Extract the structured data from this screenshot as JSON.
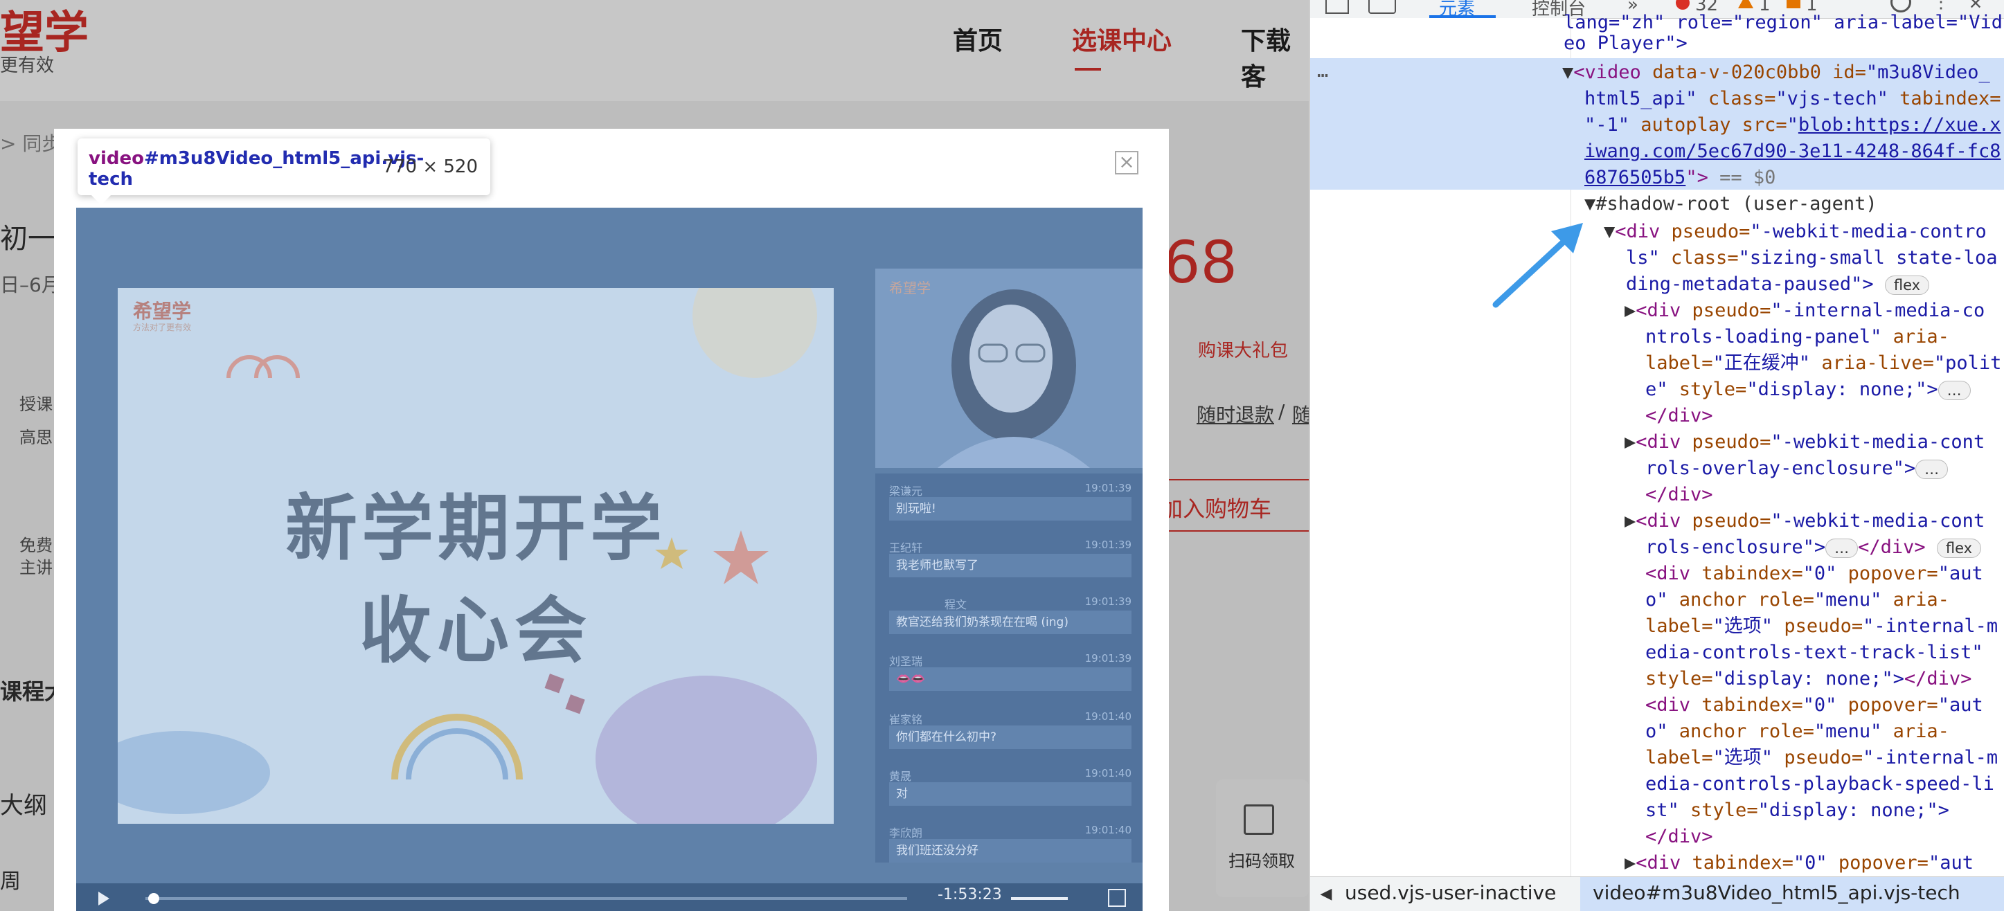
{
  "site": {
    "logo_text": "望学",
    "logo_sub": "更有效",
    "nav": [
      {
        "label": "首页"
      },
      {
        "label": "选课中心"
      },
      {
        "label": "下载客"
      }
    ],
    "breadcrumb": "> 同步",
    "course_title": "初一",
    "course_date": "日–6月",
    "price": "68",
    "gift_badge": "购课大礼包",
    "refund_text": "随时退款",
    "refund_sep": "/",
    "refund_more": "随",
    "add_cart": "加入购物车",
    "teacher_label": "授课",
    "teacher_name": "高思",
    "free_label": "免费",
    "free_sub": "主讲",
    "outline_title": "课程大纲",
    "outline_label": "大纲",
    "week_label": "周",
    "scan_label": "扫码领取"
  },
  "modal": {
    "close_label": "×",
    "tooltip_element": "video",
    "tooltip_selector": "#m3u8Video_html5_api.vjs-tech",
    "tooltip_size": "770 × 520"
  },
  "video": {
    "slide_logo": "希望学",
    "slide_logo_sub": "方法对了更有效",
    "slide_title_line1": "新学期开学",
    "slide_title_line2": "收心会",
    "teacher_logo": "希望学",
    "chat": [
      {
        "name": "梁谦元",
        "time": "19:01:39",
        "msg": "别玩啦!"
      },
      {
        "name": "王纪轩",
        "time": "19:01:39",
        "msg": "我老师也默写了"
      },
      {
        "name": "程文",
        "time": "19:01:39",
        "msg": "教官还给我们奶茶现在在喝 (ing)"
      },
      {
        "name": "刘圣瑞",
        "time": "19:01:39",
        "msg": "👄👄"
      },
      {
        "name": "崔家铭",
        "time": "19:01:40",
        "msg": "你们都在什么初中?"
      },
      {
        "name": "黄晟",
        "time": "19:01:40",
        "msg": "对"
      },
      {
        "name": "李欣朗",
        "time": "19:01:40",
        "msg": "我们班还没分好"
      }
    ],
    "time_remaining": "-1:53:23",
    "progress_fraction": 0.01
  },
  "devtools": {
    "tabs": [
      {
        "label": "元素"
      },
      {
        "label": "控制台"
      },
      {
        "label": "»"
      }
    ],
    "badges": {
      "errors": "32",
      "warnings": "1",
      "issues": "1"
    },
    "lines": {
      "l0": "lang=\"zh\" role=\"region\" aria-label=\"Vid",
      "l1": "eo Player\">",
      "dots": "…",
      "video_open_a": "<video",
      "video_attr_1": " data-v-020c0bb0 id=",
      "video_val_1": "\"m3u8Video_",
      "l3": "html5_api\"",
      "l3b": " class=",
      "l3c": "\"vjs-tech\"",
      "l3d": " tabindex=",
      "l4a": "\"-1\"",
      "l4b": " autoplay src=",
      "l4c": "\"",
      "l4link": "blob:https://xue.x",
      "l5link": "iwang.com/5ec67d90-3e11-4248-864f-fc8",
      "l6link": "6876505b5",
      "l6b": "\">",
      "l6c": " == $0",
      "shadow": "#shadow-root (user-agent)",
      "div1a": "<div",
      "div1b": " pseudo=",
      "div1c": "\"-webkit-media-contro",
      "div1d": "ls\"",
      "div1e": " class=",
      "div1f": "\"sizing-small state-loa",
      "div1g": "ding-metadata-paused\">",
      "badge_flex": "flex",
      "div2a": "\"-internal-media-co",
      "div2b": "ntrols-loading-panel\"",
      "div2c": " aria-",
      "div2d": "label=",
      "div2e": "\"正在缓冲\"",
      "div2f": " aria-live=",
      "div2g": "\"polit",
      "div2h": "e\"",
      "div2i": " style=",
      "div2j": "\"display: none;\">",
      "close_div": "</div>",
      "div3a": "\"-webkit-media-cont",
      "div3b": "rols-overlay-enclosure\">",
      "div4a": "\"-webkit-media-cont",
      "div4b": "rols-enclosure\">",
      "div5a": "<div",
      "div5b": " tabindex=",
      "div5c": "\"0\"",
      "div5d": " popover=",
      "div5e": "\"aut",
      "div5f": "o\"",
      "div5g": " anchor role=",
      "div5h": "\"menu\"",
      "div5i": " aria-",
      "div5j": "label=",
      "div5k": "\"选项\"",
      "div5l": " pseudo=",
      "div5m": "\"-internal-m",
      "div5n": "edia-controls-text-track-list\"",
      "div5o": "style=",
      "div5p": "\"display: none;\">",
      "div5q": "</div>",
      "div6n": "edia-controls-playback-speed-li",
      "div6o": "st\"",
      "div6p": " style=",
      "div6q": "\"display: none;\">",
      "div7": "\"0\""
    },
    "crumb_prev": "used.vjs-user-inactive",
    "crumb_current": "video#m3u8Video_html5_api.vjs-tech"
  },
  "colors": {
    "brand_red": "#d8312b",
    "devtools_highlight": "#cfe0f9",
    "arrow_blue": "#3d9ae8"
  }
}
